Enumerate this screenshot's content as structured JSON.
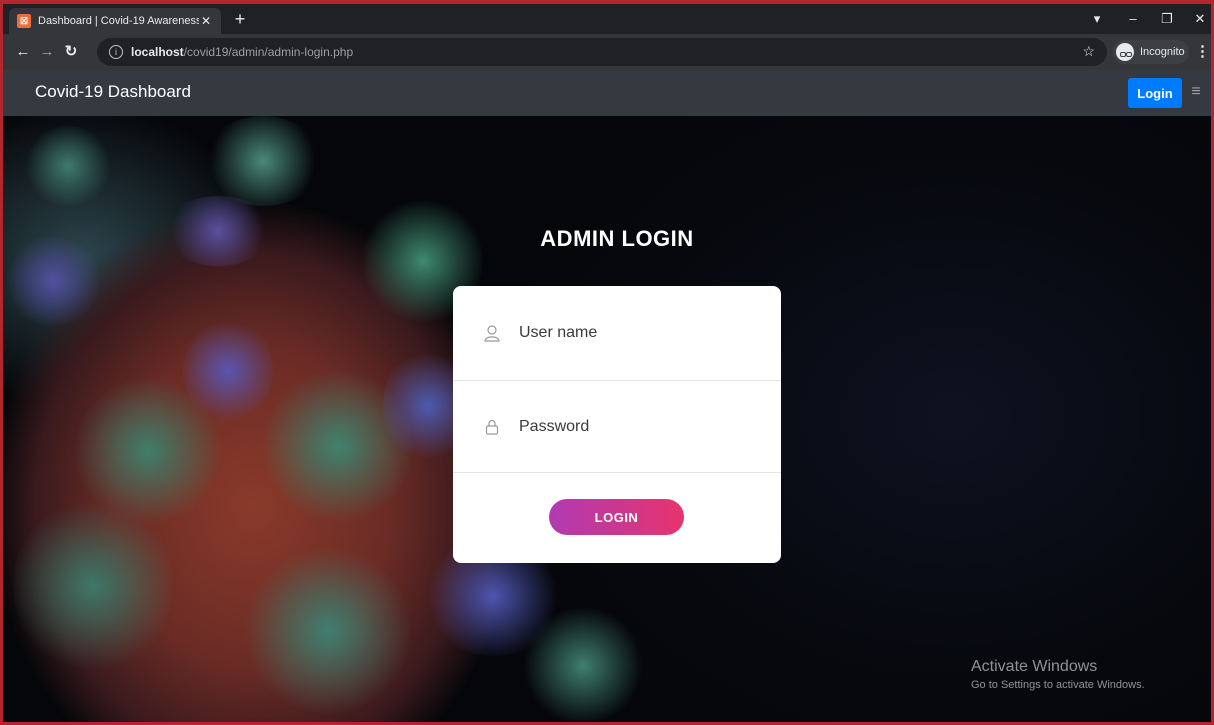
{
  "browser": {
    "tab_title": "Dashboard | Covid-19 Awareness",
    "tab_close": "✕",
    "new_tab": "+",
    "url_host": "localhost",
    "url_path": "/covid19/admin/admin-login.php",
    "incognito_label": "Incognito"
  },
  "site": {
    "brand": "Covid-19 Dashboard",
    "nav_login": "Login"
  },
  "login": {
    "title": "ADMIN LOGIN",
    "username_placeholder": "User name",
    "password_placeholder": "Password",
    "submit_label": "LOGIN",
    "button_gradient": [
      "#b03ab3",
      "#e8336e"
    ]
  },
  "watermark": {
    "line1": "Activate Windows",
    "line2": "Go to Settings to activate Windows."
  },
  "colors": {
    "nav_bg": "#343a40",
    "nav_login_bg": "#007bff"
  }
}
